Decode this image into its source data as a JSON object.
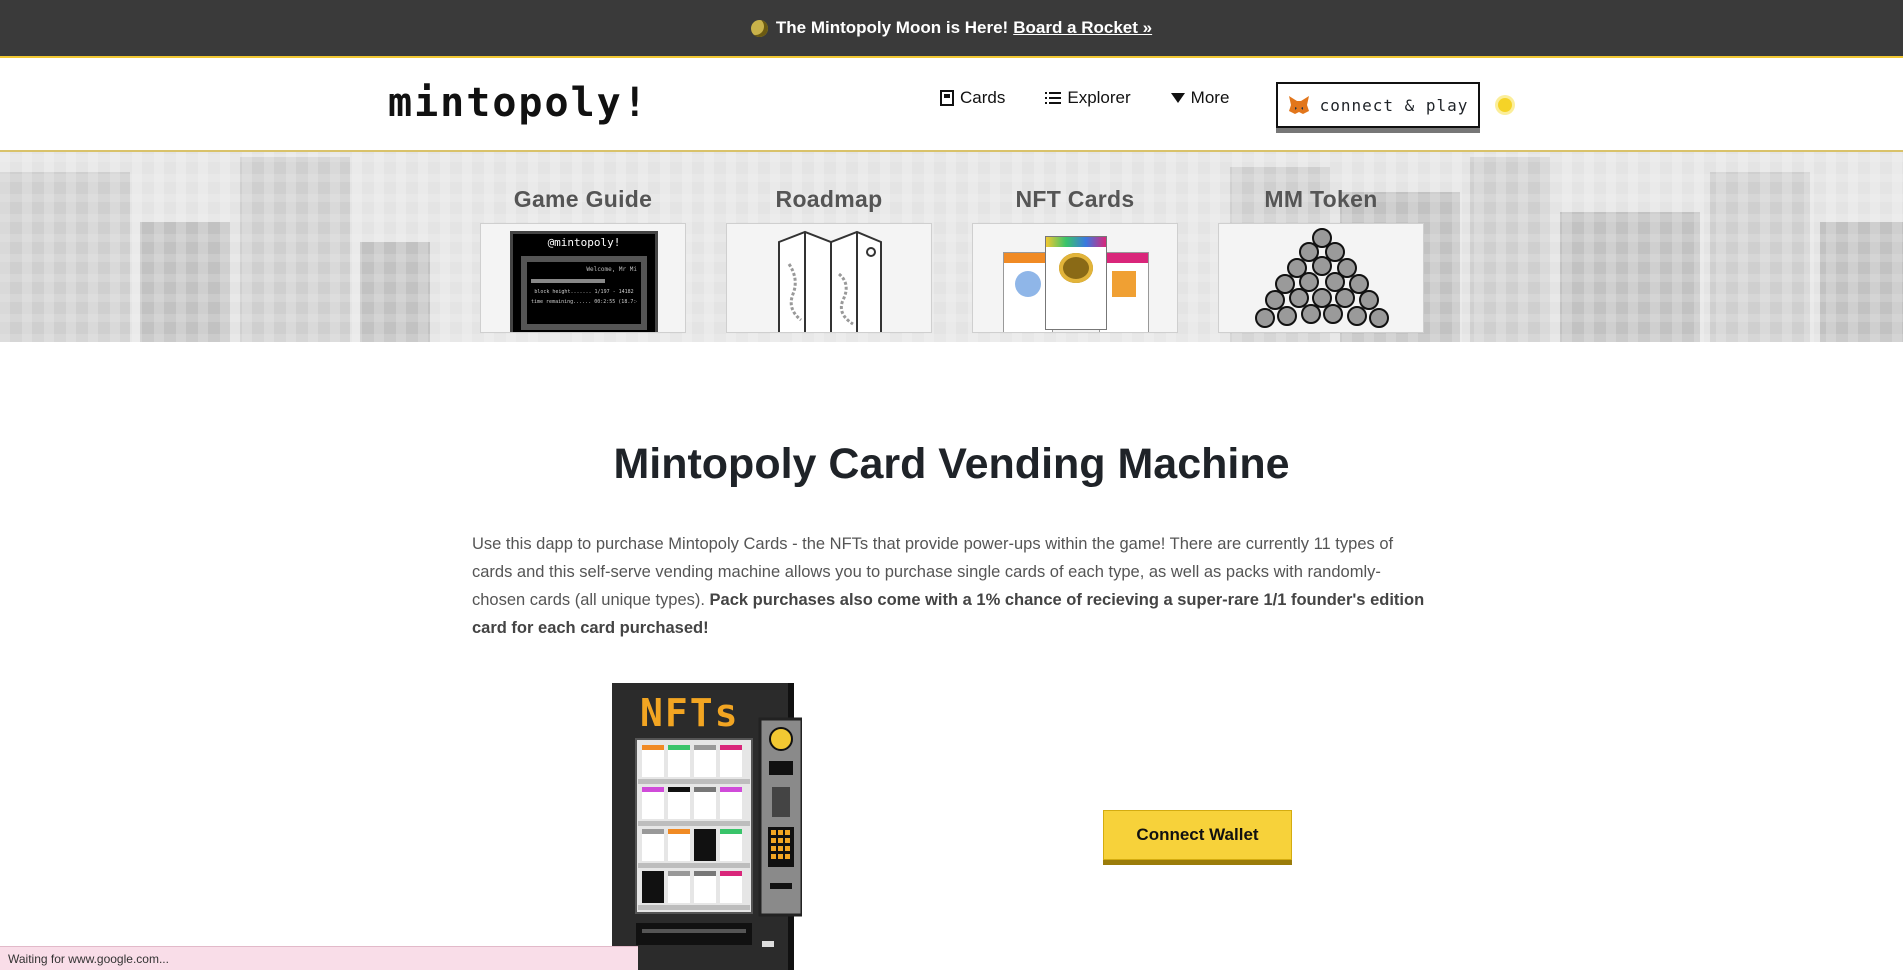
{
  "announcement": {
    "text": "The Mintopoly Moon is Here!",
    "link": "Board a Rocket »"
  },
  "header": {
    "logo": "mintopoly!",
    "nav": [
      {
        "label": "Cards",
        "icon": "card-icon"
      },
      {
        "label": "Explorer",
        "icon": "list-icon"
      },
      {
        "label": "More",
        "icon": "caret-down-icon"
      }
    ],
    "connect_label": "connect & play",
    "theme_toggle_icon": "sun-icon"
  },
  "hero": {
    "cards": [
      {
        "title": "Game Guide"
      },
      {
        "title": "Roadmap"
      },
      {
        "title": "NFT Cards"
      },
      {
        "title": "MM Token"
      }
    ],
    "guide_screen": {
      "handle": "@mintopoly!",
      "greeting": "Welcome, Mr Mi",
      "row1": "block height.......  1/197 - 14182",
      "row2": "time remaining......  00:2:55 (18.7:4) ds"
    }
  },
  "main": {
    "title": "Mintopoly Card Vending Machine",
    "intro_plain": "Use this dapp to purchase Mintopoly Cards - the NFTs that provide power-ups within the game! There are currently 11 types of cards and this self-serve vending machine allows you to purchase single cards of each type, as well as packs with randomly-chosen cards (all unique types). ",
    "intro_bold": "Pack purchases also come with a 1% chance of recieving a super-rare 1/1 founder's edition card for each card purchased!",
    "vending_label": "NFTs",
    "connect_wallet": "Connect Wallet"
  },
  "status_bar": {
    "text": "Waiting for www.google.com..."
  },
  "colors": {
    "accent_yellow": "#f7d23a",
    "dark_bar": "#3a3a3a"
  }
}
